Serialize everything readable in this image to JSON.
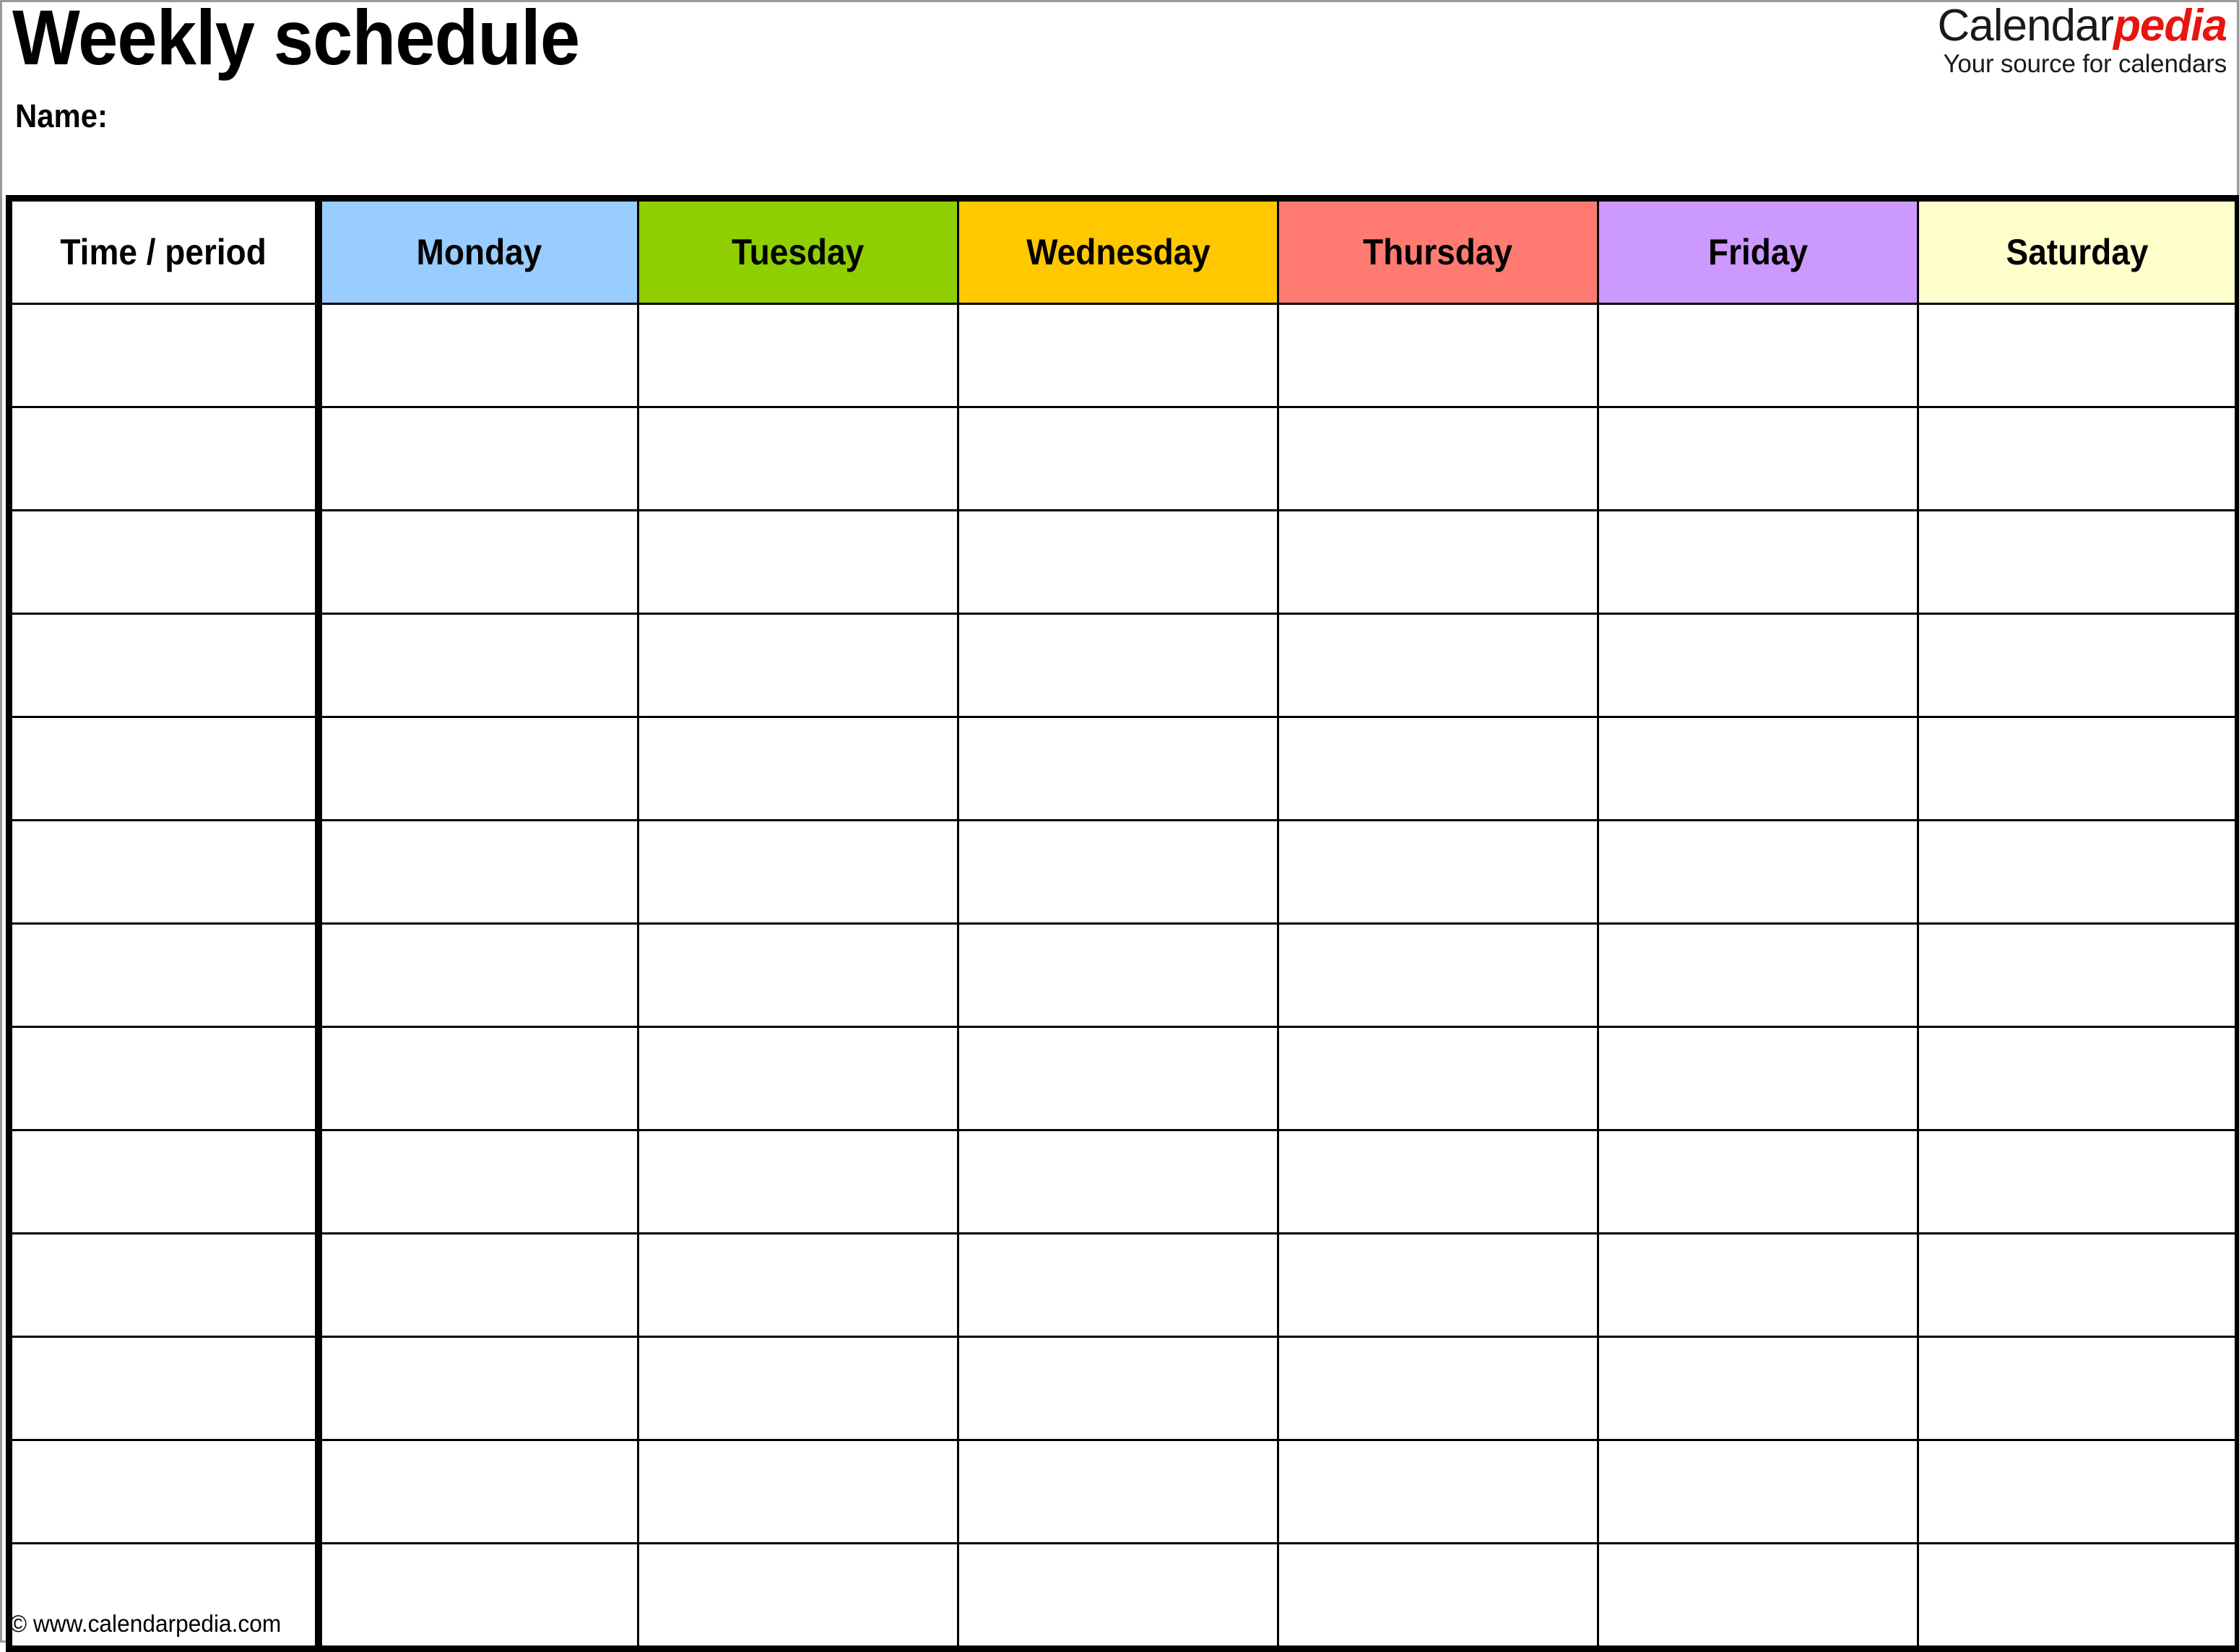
{
  "document": {
    "title": "Weekly schedule",
    "name_label": "Name:"
  },
  "brand": {
    "word_primary": "Calendar",
    "word_accent": "pedia",
    "tagline": "Your source for calendars",
    "accent_color": "#e8140f",
    "primary_color": "#1a1a1a"
  },
  "table": {
    "columns": [
      {
        "label": "Time / period",
        "key": "time",
        "bg": "#ffffff"
      },
      {
        "label": "Monday",
        "key": "monday",
        "bg": "#99ccff"
      },
      {
        "label": "Tuesday",
        "key": "tuesday",
        "bg": "#8fce00"
      },
      {
        "label": "Wednesday",
        "key": "wednesday",
        "bg": "#ffc800"
      },
      {
        "label": "Thursday",
        "key": "thursday",
        "bg": "#ff7b72"
      },
      {
        "label": "Friday",
        "key": "friday",
        "bg": "#cc99ff"
      },
      {
        "label": "Saturday",
        "key": "saturday",
        "bg": "#ffffcc"
      }
    ],
    "row_count": 13,
    "rows": [
      {
        "time": "",
        "monday": "",
        "tuesday": "",
        "wednesday": "",
        "thursday": "",
        "friday": "",
        "saturday": ""
      },
      {
        "time": "",
        "monday": "",
        "tuesday": "",
        "wednesday": "",
        "thursday": "",
        "friday": "",
        "saturday": ""
      },
      {
        "time": "",
        "monday": "",
        "tuesday": "",
        "wednesday": "",
        "thursday": "",
        "friday": "",
        "saturday": ""
      },
      {
        "time": "",
        "monday": "",
        "tuesday": "",
        "wednesday": "",
        "thursday": "",
        "friday": "",
        "saturday": ""
      },
      {
        "time": "",
        "monday": "",
        "tuesday": "",
        "wednesday": "",
        "thursday": "",
        "friday": "",
        "saturday": ""
      },
      {
        "time": "",
        "monday": "",
        "tuesday": "",
        "wednesday": "",
        "thursday": "",
        "friday": "",
        "saturday": ""
      },
      {
        "time": "",
        "monday": "",
        "tuesday": "",
        "wednesday": "",
        "thursday": "",
        "friday": "",
        "saturday": ""
      },
      {
        "time": "",
        "monday": "",
        "tuesday": "",
        "wednesday": "",
        "thursday": "",
        "friday": "",
        "saturday": ""
      },
      {
        "time": "",
        "monday": "",
        "tuesday": "",
        "wednesday": "",
        "thursday": "",
        "friday": "",
        "saturday": ""
      },
      {
        "time": "",
        "monday": "",
        "tuesday": "",
        "wednesday": "",
        "thursday": "",
        "friday": "",
        "saturday": ""
      },
      {
        "time": "",
        "monday": "",
        "tuesday": "",
        "wednesday": "",
        "thursday": "",
        "friday": "",
        "saturday": ""
      },
      {
        "time": "",
        "monday": "",
        "tuesday": "",
        "wednesday": "",
        "thursday": "",
        "friday": "",
        "saturday": ""
      },
      {
        "time": "",
        "monday": "",
        "tuesday": "",
        "wednesday": "",
        "thursday": "",
        "friday": "",
        "saturday": ""
      }
    ]
  },
  "footer": {
    "copyright": "© www.calendarpedia.com"
  }
}
